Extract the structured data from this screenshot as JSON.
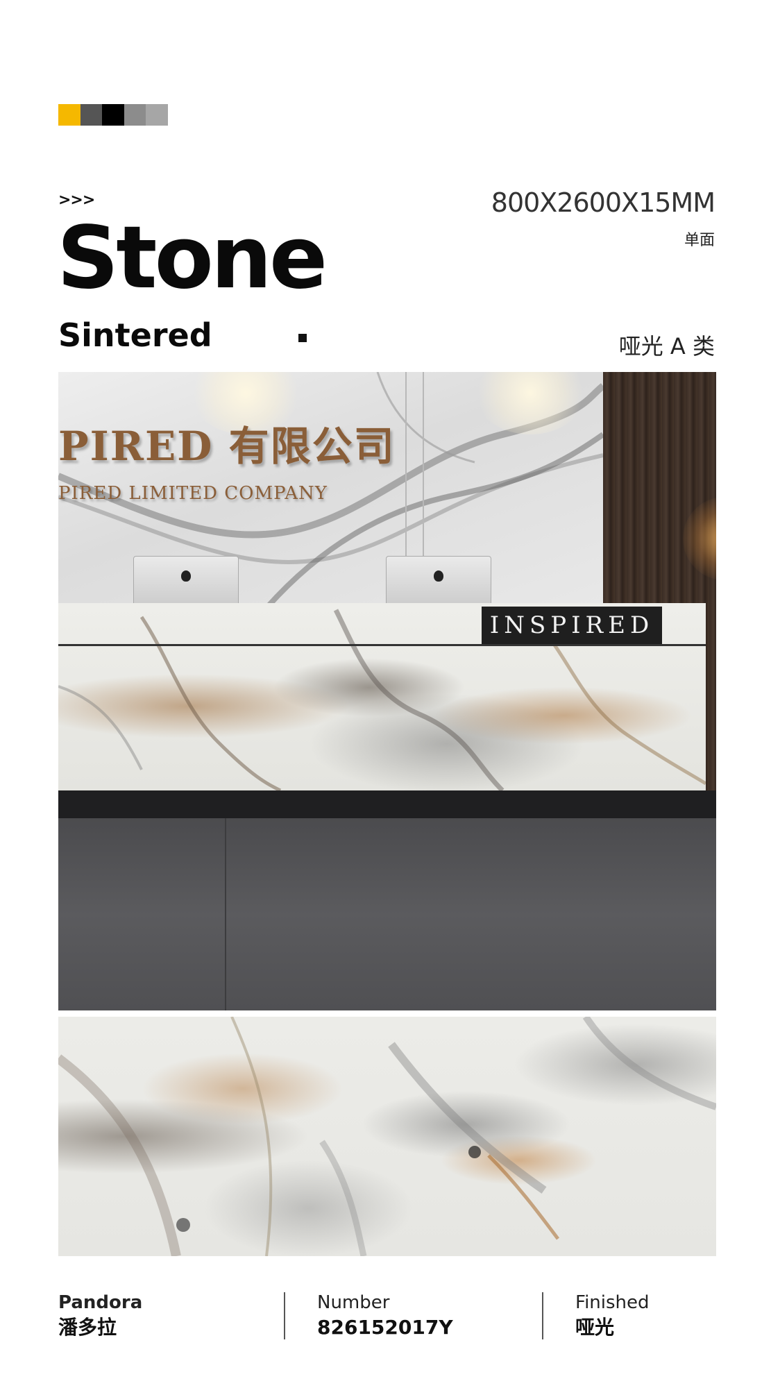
{
  "header": {
    "swatch_colors": [
      "#f5b800",
      "#555555",
      "#000000",
      "#8c8c8c",
      "#a6a6a6"
    ],
    "chevrons": ">>>",
    "title": "Stone",
    "subtitle": "Sintered",
    "dimensions": "800X2600X15MM",
    "face": "单面",
    "grade": "哑光 A 类"
  },
  "scene": {
    "sign_cn": "PIRED 有限公司",
    "sign_en": "PIRED LIMITED COMPANY",
    "counter_sign": "INSPIRED"
  },
  "footer": {
    "name_label": "Pandora",
    "name_value": "潘多拉",
    "number_label": "Number",
    "number_value": "826152017Y",
    "finish_label": "Finished",
    "finish_value": "哑光"
  }
}
